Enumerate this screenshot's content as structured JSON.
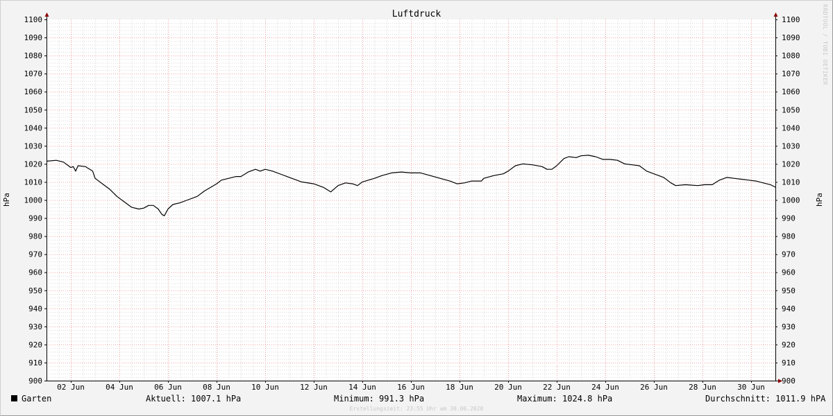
{
  "chart_data": {
    "type": "line",
    "title": "Luftdruck",
    "ylabel_left": "hPa",
    "ylabel_right": "hPa",
    "ylim": [
      900,
      1100
    ],
    "y_major_step": 10,
    "y_ticks": [
      "1100",
      "1090",
      "1080",
      "1070",
      "1060",
      "1050",
      "1040",
      "1030",
      "1020",
      "1010",
      "1000",
      "990",
      "980",
      "970",
      "960",
      "950",
      "940",
      "930",
      "920",
      "910",
      "900"
    ],
    "xlim_days": [
      1,
      31
    ],
    "x_ticks": [
      {
        "day": 2,
        "label": "02 Jun"
      },
      {
        "day": 4,
        "label": "04 Jun"
      },
      {
        "day": 6,
        "label": "06 Jun"
      },
      {
        "day": 8,
        "label": "08 Jun"
      },
      {
        "day": 10,
        "label": "10 Jun"
      },
      {
        "day": 12,
        "label": "12 Jun"
      },
      {
        "day": 14,
        "label": "14 Jun"
      },
      {
        "day": 16,
        "label": "16 Jun"
      },
      {
        "day": 18,
        "label": "18 Jun"
      },
      {
        "day": 20,
        "label": "20 Jun"
      },
      {
        "day": 22,
        "label": "22 Jun"
      },
      {
        "day": 24,
        "label": "24 Jun"
      },
      {
        "day": 26,
        "label": "26 Jun"
      },
      {
        "day": 28,
        "label": "28 Jun"
      },
      {
        "day": 30,
        "label": "30 Jun"
      }
    ],
    "series": [
      {
        "name": "Garten",
        "color": "#000000",
        "points": [
          [
            1.0,
            1021.5
          ],
          [
            1.4,
            1022
          ],
          [
            1.7,
            1021
          ],
          [
            1.9,
            1019
          ],
          [
            2.0,
            1018
          ],
          [
            2.1,
            1018.5
          ],
          [
            2.2,
            1016
          ],
          [
            2.3,
            1019
          ],
          [
            2.6,
            1018.5
          ],
          [
            2.9,
            1016
          ],
          [
            3.0,
            1012
          ],
          [
            3.3,
            1009
          ],
          [
            3.6,
            1006
          ],
          [
            3.9,
            1002
          ],
          [
            4.2,
            999
          ],
          [
            4.5,
            996
          ],
          [
            4.8,
            995
          ],
          [
            5.0,
            995.5
          ],
          [
            5.2,
            997
          ],
          [
            5.4,
            997
          ],
          [
            5.6,
            995
          ],
          [
            5.75,
            992
          ],
          [
            5.85,
            991.3
          ],
          [
            6.0,
            995
          ],
          [
            6.2,
            997.5
          ],
          [
            6.5,
            998.5
          ],
          [
            6.8,
            1000
          ],
          [
            7.2,
            1002
          ],
          [
            7.5,
            1005
          ],
          [
            8.0,
            1009
          ],
          [
            8.2,
            1011
          ],
          [
            8.5,
            1012
          ],
          [
            8.8,
            1013
          ],
          [
            9.0,
            1013
          ],
          [
            9.3,
            1015.5
          ],
          [
            9.6,
            1017
          ],
          [
            9.8,
            1016
          ],
          [
            10.0,
            1017
          ],
          [
            10.3,
            1016
          ],
          [
            10.7,
            1014
          ],
          [
            11.0,
            1012.5
          ],
          [
            11.5,
            1010
          ],
          [
            12.0,
            1009
          ],
          [
            12.4,
            1007
          ],
          [
            12.7,
            1004.5
          ],
          [
            13.0,
            1008
          ],
          [
            13.3,
            1009.5
          ],
          [
            13.6,
            1009
          ],
          [
            13.8,
            1008
          ],
          [
            14.0,
            1010
          ],
          [
            14.5,
            1012
          ],
          [
            14.8,
            1013.5
          ],
          [
            15.2,
            1015
          ],
          [
            15.6,
            1015.5
          ],
          [
            16.0,
            1015
          ],
          [
            16.4,
            1015
          ],
          [
            16.8,
            1013.5
          ],
          [
            17.2,
            1012
          ],
          [
            17.6,
            1010.5
          ],
          [
            17.9,
            1009
          ],
          [
            18.2,
            1009.5
          ],
          [
            18.5,
            1010.5
          ],
          [
            18.9,
            1010.5
          ],
          [
            19.0,
            1012
          ],
          [
            19.4,
            1013.5
          ],
          [
            19.8,
            1014.5
          ],
          [
            20.0,
            1016
          ],
          [
            20.3,
            1019
          ],
          [
            20.6,
            1020
          ],
          [
            21.0,
            1019.5
          ],
          [
            21.4,
            1018.5
          ],
          [
            21.6,
            1017
          ],
          [
            21.8,
            1017
          ],
          [
            22.0,
            1019
          ],
          [
            22.3,
            1023
          ],
          [
            22.5,
            1024
          ],
          [
            22.8,
            1023.5
          ],
          [
            23.0,
            1024.5
          ],
          [
            23.3,
            1024.8
          ],
          [
            23.6,
            1024
          ],
          [
            23.9,
            1022.5
          ],
          [
            24.2,
            1022.5
          ],
          [
            24.5,
            1022
          ],
          [
            24.8,
            1020
          ],
          [
            25.1,
            1019.5
          ],
          [
            25.4,
            1019
          ],
          [
            25.7,
            1016
          ],
          [
            26.0,
            1014.5
          ],
          [
            26.4,
            1012.5
          ],
          [
            26.7,
            1009.5
          ],
          [
            26.9,
            1008
          ],
          [
            27.3,
            1008.5
          ],
          [
            27.8,
            1008
          ],
          [
            28.1,
            1008.5
          ],
          [
            28.4,
            1008.5
          ],
          [
            28.7,
            1011
          ],
          [
            29.0,
            1012.5
          ],
          [
            29.3,
            1012
          ],
          [
            29.6,
            1011.5
          ],
          [
            29.9,
            1011
          ],
          [
            30.2,
            1010.5
          ],
          [
            30.5,
            1009.5
          ],
          [
            30.8,
            1008.5
          ],
          [
            31.0,
            1007.1
          ]
        ]
      }
    ]
  },
  "legend": {
    "series_name": "Garten",
    "current": "Aktuell: 1007.1 hPa",
    "minimum": "Minimum: 991.3 hPa",
    "maximum": "Maximum: 1024.8 hPa",
    "average": "Durchschnitt: 1011.9 hPA"
  },
  "footer": "Erstellungszeit: 23:55 Uhr am 30.06.2020",
  "watermark": "RRDTOOL / TOBI OETIKER",
  "colors": {
    "background": "#f3f3f3",
    "plot_bg": "#ffffff",
    "major_grid": "#f0a0a0",
    "minor_grid": "#d8d8d8",
    "axis": "#000000",
    "arrow": "#8b0000",
    "line": "#000000"
  }
}
